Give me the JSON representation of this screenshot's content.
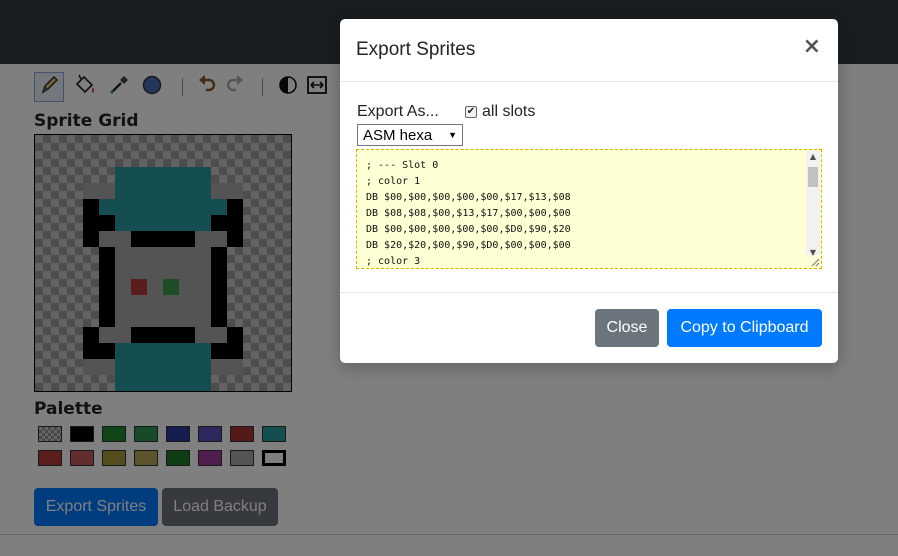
{
  "toolbar": {
    "tools": [
      {
        "id": "pencil",
        "icon": "pencil-icon",
        "active": true
      },
      {
        "id": "fill",
        "icon": "paint-bucket-icon",
        "active": false
      },
      {
        "id": "picker",
        "icon": "eyedropper-icon",
        "active": false
      },
      {
        "id": "circle",
        "icon": "circle-icon",
        "active": false
      },
      {
        "id": "undo",
        "icon": "undo-icon",
        "active": false
      },
      {
        "id": "redo",
        "icon": "redo-icon",
        "active": false
      },
      {
        "id": "invert",
        "icon": "contrast-icon",
        "active": false
      },
      {
        "id": "flip",
        "icon": "flip-horizontal-icon",
        "active": false
      }
    ]
  },
  "sprite_grid": {
    "label": "Sprite Grid",
    "colors": {
      "1": "#000000",
      "4": "#2a9ca3",
      "8": "#a8a8a8",
      "5": "#b33a3a",
      "6": "#3a9a4a"
    }
  },
  "palette": {
    "label": "Palette",
    "colors": [
      "checker",
      "#000000",
      "#1e8a2e",
      "#2f9450",
      "#2c3aa0",
      "#5a52b8",
      "#a83232",
      "#2a9ca3",
      "#b83a3a",
      "#c85a5a",
      "#a89a3a",
      "#b8a858",
      "#1c7a28",
      "#a03c9c",
      "#a8a8a8",
      "#ffffff"
    ],
    "selected_index": 15
  },
  "buttons": {
    "export": "Export Sprites",
    "load_backup": "Load Backup"
  },
  "modal": {
    "title": "Export Sprites",
    "close_symbol": "×",
    "export_as_label": "Export As...",
    "all_slots_label": "all slots",
    "all_slots_checked": true,
    "format_selected": "ASM hexa",
    "code_lines": [
      "; --- Slot 0",
      "; color 1",
      "DB $00,$00,$00,$00,$00,$17,$13,$08",
      "DB $08,$08,$00,$13,$17,$00,$00,$00",
      "DB $00,$00,$00,$00,$00,$D0,$90,$20",
      "DB $20,$20,$00,$90,$D0,$00,$00,$00",
      "; color 3"
    ],
    "close_button": "Close",
    "copy_button": "Copy to Clipboard"
  },
  "colors": {
    "topbar": "#343a40",
    "primary": "#007bff",
    "secondary": "#6c757d",
    "code_bg": "#ffffd6"
  }
}
